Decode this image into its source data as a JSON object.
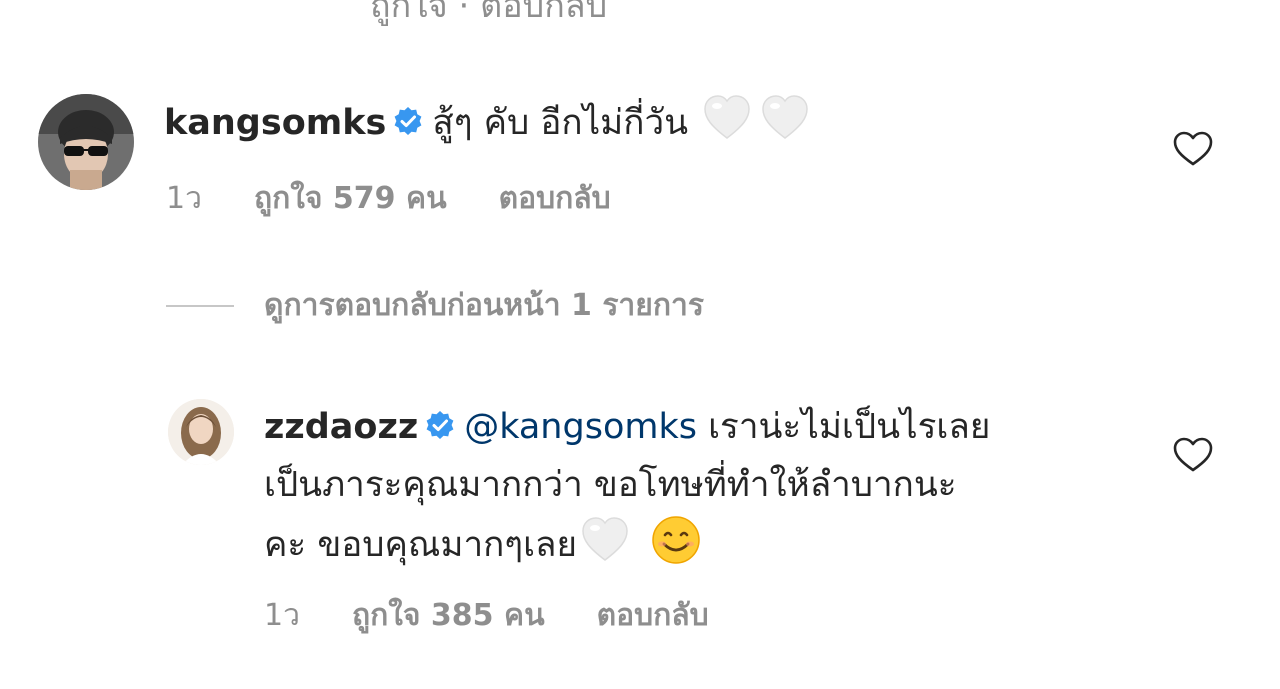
{
  "cutoff_text": "ถูกใจ · ตอบกลับ",
  "comments": [
    {
      "username": "kangsomks",
      "verified": true,
      "text": "สู้ๆ คับ อีกไม่กี่วัน",
      "emoji": [
        "white-heart",
        "white-heart"
      ],
      "time": "1ว",
      "likes": "ถูกใจ 579 คน",
      "reply": "ตอบกลับ"
    }
  ],
  "view_replies": "ดูการตอบกลับก่อนหน้า 1 รายการ",
  "reply_comment": {
    "username": "zzdaozz",
    "verified": true,
    "mention": "@kangsomks",
    "line1": "เราน่ะไม่เป็นไรเลย",
    "line2": "เป็นภาระคุณมากกว่า ขอโทษที่ทำให้ลำบากนะ",
    "line3": "คะ ขอบคุณมากๆเลย",
    "emoji": [
      "white-heart",
      "smiling-face"
    ],
    "time": "1ว",
    "likes": "ถูกใจ 385 คน",
    "reply": "ตอบกลับ"
  },
  "colors": {
    "text": "#262626",
    "secondary": "#8e8e8e",
    "mention": "#00376b",
    "verified": "#3897f0"
  }
}
